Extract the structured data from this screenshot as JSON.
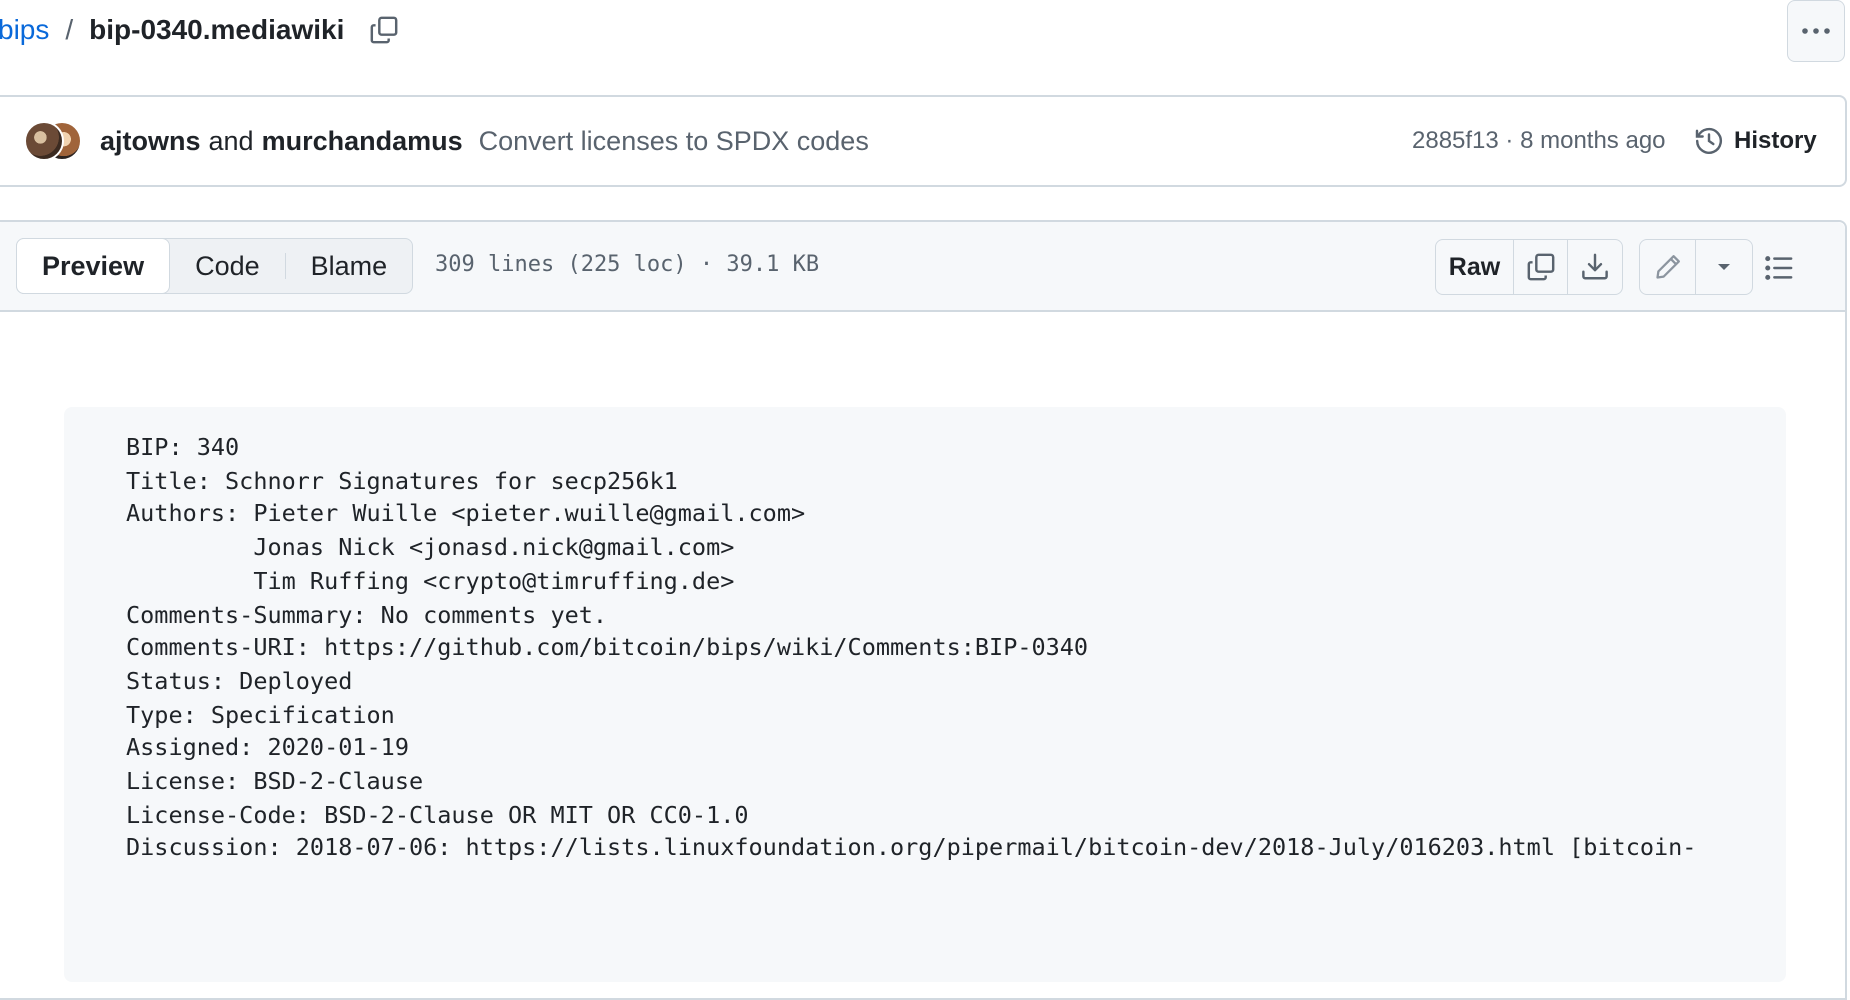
{
  "breadcrumb": {
    "repo": "bips",
    "separator": "/",
    "file": "bip-0340.mediawiki"
  },
  "commit": {
    "author1": "ajtowns",
    "and": "and",
    "author2": "murchandamus",
    "message": "Convert licenses to SPDX codes",
    "meta": "2885f13 · 8 months ago",
    "history_label": "History"
  },
  "file_header": {
    "tabs": [
      "Preview",
      "Code",
      "Blame"
    ],
    "active_tab": "Preview",
    "stats": "309 lines (225 loc) · 39.1 KB",
    "raw_label": "Raw"
  },
  "icons": {
    "copy_path": "copy-icon",
    "more": "kebab-horizontal-icon",
    "history": "history-icon",
    "copy_raw": "copy-icon",
    "download": "download-icon",
    "edit": "pencil-icon",
    "dropdown": "triangle-down-icon",
    "outline": "list-unordered-icon"
  },
  "preamble": [
    "BIP: 340",
    "Title: Schnorr Signatures for secp256k1",
    "Authors: Pieter Wuille <pieter.wuille@gmail.com>",
    "         Jonas Nick <jonasd.nick@gmail.com>",
    "         Tim Ruffing <crypto@timruffing.de>",
    "Comments-Summary: No comments yet.",
    "Comments-URI: https://github.com/bitcoin/bips/wiki/Comments:BIP-0340",
    "Status: Deployed",
    "Type: Specification",
    "Assigned: 2020-01-19",
    "License: BSD-2-Clause",
    "License-Code: BSD-2-Clause OR MIT OR CC0-1.0",
    "Discussion: 2018-07-06: https://lists.linuxfoundation.org/pipermail/bitcoin-dev/2018-July/016203.html [bitcoin-"
  ],
  "colors": {
    "link": "#0969da",
    "muted": "#59636e",
    "border": "#d1d9e0",
    "canvas_subtle": "#f6f8fa"
  }
}
